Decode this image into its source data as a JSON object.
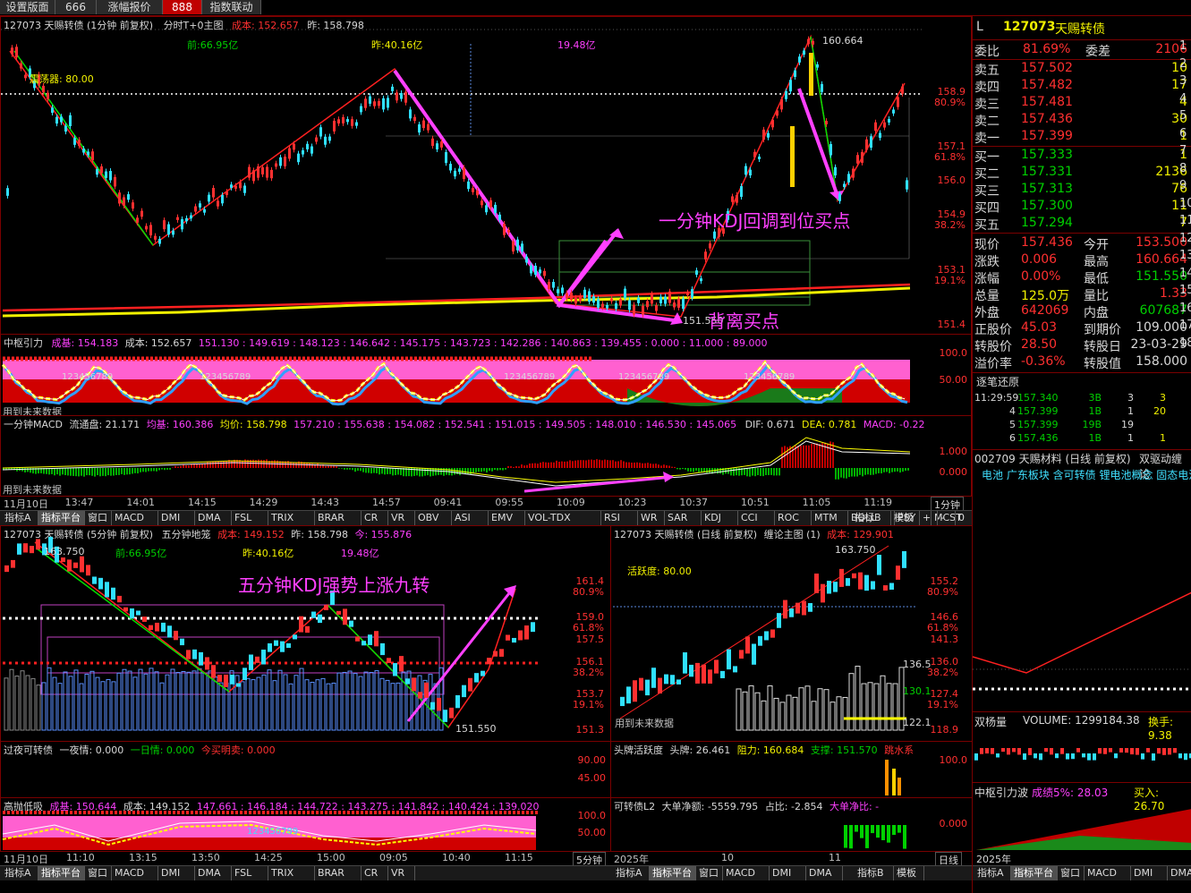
{
  "top_tabs": [
    "设置版面",
    "666",
    "涨幅报价",
    "888",
    "指数联动"
  ],
  "active_tab": "888",
  "minute_chart": {
    "title_code": "127073 天赐转债 (1分钟 前复权)",
    "title_mode": "分时T+0主图",
    "cost_label": "成本: 152.657",
    "prev_label": "昨: 158.798",
    "note_prev": "前:66.95亿",
    "note_yest": "昨:40.16亿",
    "note_amt": "19.48亿",
    "osc_label": "震荡器: 80.00",
    "high_label": "160.664",
    "low_label": "151.550",
    "y_ticks": [
      {
        "v": "158.9",
        "p": "80.9%"
      },
      {
        "v": "157.1",
        "p": "61.8%"
      },
      {
        "v": "156.0",
        "p": ""
      },
      {
        "v": "154.9",
        "p": "38.2%"
      },
      {
        "v": "153.1",
        "p": "19.1%"
      },
      {
        "v": "151.4",
        "p": ""
      }
    ],
    "annot_buy": "一分钟KDJ回调到位买点",
    "annot_div": "背离买点"
  },
  "zhongshu": {
    "title": "中枢引力",
    "cost_base": "成基: 154.183",
    "cost": "成本: 152.657",
    "levels": "151.130 : 149.619 : 148.123 : 146.642 : 145.175 : 143.723 : 142.286 : 140.863 : 139.455 : 0.000 : 11.000 : 89.000",
    "y1": "100.0",
    "y2": "50.00",
    "note": "用到未来数据",
    "seq": "123456789"
  },
  "macd": {
    "title": "一分钟MACD",
    "float": "流通盘: 21.171",
    "avgbase": "均基: 160.386",
    "avg": "均价: 158.798",
    "levels": "157.210 : 155.638 : 154.082 : 152.541 : 151.015 : 149.505 : 148.010 : 146.530 : 145.065",
    "dif": "DIF: 0.671",
    "dea": "DEA: 0.781",
    "macd": "MACD: -0.22",
    "y1": "1.000",
    "y2": "0.000",
    "note": "用到未来数据"
  },
  "minute_times": [
    "11月10日",
    "13:47",
    "14:01",
    "14:15",
    "14:29",
    "14:43",
    "14:57",
    "09:41",
    "09:55",
    "10:09",
    "10:23",
    "10:37",
    "10:51",
    "11:05",
    "11:19"
  ],
  "period_tag": "1分钟",
  "indicator_tabs": [
    "指标A",
    "指标平台",
    "窗口",
    "MACD",
    "DMI",
    "DMA",
    "FSL",
    "TRIX",
    "BRAR",
    "CR",
    "VR",
    "OBV",
    "ASI",
    "EMV",
    "VOL-TDX",
    "RSI",
    "WR",
    "SAR",
    "KDJ",
    "CCI",
    "ROC",
    "MTM",
    "BOLL",
    "PSY",
    "MCST",
    "更多",
    "设置",
    "指标B",
    "模板",
    "+",
    "-",
    "0"
  ],
  "five_min": {
    "title_code": "127073 天赐转债 (5分钟 前复权)",
    "title_mode": "五分钟地笼",
    "cost": "成本: 149.152",
    "prev": "昨: 158.798",
    "avg": "今: 155.876",
    "high_label": "163.750",
    "low_label": "151.550",
    "note_prev": "前:66.95亿",
    "note_yest": "昨:40.16亿",
    "note_amt": "19.48亿",
    "annot": "五分钟KDJ强势上涨九转",
    "y_ticks": [
      {
        "v": "161.4",
        "p": "80.9%"
      },
      {
        "v": "159.0",
        "p": "61.8%"
      },
      {
        "v": "157.5",
        "p": ""
      },
      {
        "v": "156.1",
        "p": "38.2%"
      },
      {
        "v": "153.7",
        "p": "19.1%"
      },
      {
        "v": "151.3",
        "p": ""
      }
    ]
  },
  "overnight": {
    "title": "过夜可转债",
    "mood": "一夜情: 0.000",
    "day": "一日情: 0.000",
    "today": "今买明卖: 0.000",
    "y1": "90.00",
    "y2": "45.00"
  },
  "high_low": {
    "title": "高抛低吸",
    "base": "成基: 150.644",
    "cost": "成本: 149.152",
    "levels": "147.661 : 146.184 : 144.722 : 143.275 : 141.842 : 140.424 : 139.020",
    "y1": "100.0",
    "y2": "50.00",
    "seq": "123456789"
  },
  "five_times": [
    "11月10日",
    "11:10",
    "13:15",
    "13:50",
    "14:25",
    "15:00",
    "09:05",
    "10:40",
    "11:15"
  ],
  "five_tag": "5分钟",
  "daily": {
    "title_code": "127073 天赐转债 (日线 前复权)",
    "title_mode": "缠论主图 (1)",
    "cost": "成本: 129.901",
    "activity": "活跃度: 80.00",
    "high_label": "163.750",
    "v1": "136.5",
    "v2": "130.1",
    "v3": "122.1",
    "y_ticks": [
      {
        "v": "155.2",
        "p": "80.9%"
      },
      {
        "v": "146.6",
        "p": "61.8%"
      },
      {
        "v": "141.3",
        "p": ""
      },
      {
        "v": "136.0",
        "p": "38.2%"
      },
      {
        "v": "127.4",
        "p": "19.1%"
      },
      {
        "v": "118.9",
        "p": ""
      }
    ],
    "note": "用到未来数据"
  },
  "head_activity": {
    "title": "头牌活跃度",
    "head": "头牌: 26.461",
    "resist": "阻力: 160.684",
    "support": "支撑: 151.570",
    "jump": "跳水系",
    "y1": "100.0"
  },
  "l2": {
    "title": "可转债L2",
    "net": "大单净额: -5559.795",
    "ratio": "占比: -2.854",
    "netratio": "大单净比: -",
    "y1": "0.000"
  },
  "daily_times": [
    "2025年",
    "10",
    "11"
  ],
  "daily_tag": "日线",
  "quote": {
    "code": "127073",
    "name": "天赐转债",
    "wb_label": "委比",
    "wb": "81.69%",
    "wc_label": "委差",
    "wc": "2106",
    "asks": [
      {
        "l": "卖五",
        "p": "157.502",
        "v": "10"
      },
      {
        "l": "卖四",
        "p": "157.482",
        "v": "17"
      },
      {
        "l": "卖三",
        "p": "157.481",
        "v": "4"
      },
      {
        "l": "卖二",
        "p": "157.436",
        "v": "30"
      },
      {
        "l": "卖一",
        "p": "157.399",
        "v": "1"
      }
    ],
    "bids": [
      {
        "l": "买一",
        "p": "157.333",
        "v": "1"
      },
      {
        "l": "买二",
        "p": "157.331",
        "v": "2136"
      },
      {
        "l": "买三",
        "p": "157.313",
        "v": "76"
      },
      {
        "l": "买四",
        "p": "157.300",
        "v": "11"
      },
      {
        "l": "买五",
        "p": "157.294",
        "v": "7"
      }
    ],
    "stats": [
      {
        "l1": "现价",
        "v1": "157.436",
        "l2": "今开",
        "v2": "153.500"
      },
      {
        "l1": "涨跌",
        "v1": "0.006",
        "l2": "最高",
        "v2": "160.664"
      },
      {
        "l1": "涨幅",
        "v1": "0.00%",
        "l2": "最低",
        "v2": "151.550"
      },
      {
        "l1": "总量",
        "v1": "125.0万",
        "l2": "量比",
        "v2": "1.33"
      },
      {
        "l1": "外盘",
        "v1": "642069",
        "l2": "内盘",
        "v2": "607687"
      },
      {
        "l1": "正股价",
        "v1": "45.03",
        "l2": "到期价",
        "v2": "109.000"
      },
      {
        "l1": "转股价",
        "v1": "28.50",
        "l2": "转股日",
        "v2": "23-03-29"
      },
      {
        "l1": "溢价率",
        "v1": "-0.36%",
        "l2": "转股值",
        "v2": "158.000"
      }
    ],
    "ticks_title": "逐笔还原",
    "ticks": [
      {
        "t": "11:29:59",
        "p": "157.340",
        "n": "3B",
        "a": "3",
        "b": "3"
      },
      {
        "t": "4",
        "p": "157.399",
        "n": "1B",
        "a": "1",
        "b": "20"
      },
      {
        "t": "5",
        "p": "157.399",
        "n": "19B",
        "a": "19",
        "b": ""
      },
      {
        "t": "6",
        "p": "157.436",
        "n": "1B",
        "a": "1",
        "b": "1"
      }
    ],
    "stock_line": "002709 天赐材料 (日线 前复权)",
    "stock_mode": "双驱动缠论",
    "concepts": "电池  广东板块  含可转债  锂电池概念  固态电池",
    "vol_title": "双杨量",
    "vol": "VOLUME: 1299184.38",
    "turnover": "换手: 9.38",
    "zs_title": "中枢引力波",
    "zs_rate": "成绩5%: 28.03",
    "zs_buy": "买入: 26.70",
    "year": "2025年",
    "right_nums": [
      "1",
      "2",
      "3",
      "4",
      "5",
      "6",
      "7",
      "8",
      "9",
      "10",
      "11",
      "12",
      "13",
      "14",
      "15",
      "16",
      "17",
      "18"
    ]
  },
  "bottom_tabs_left": [
    "指标A",
    "指标平台",
    "窗口",
    "MACD",
    "DMI",
    "DMA",
    "FSL",
    "TRIX",
    "BRAR",
    "CR",
    "VR"
  ],
  "bottom_tabs_mid": [
    "指标A",
    "指标平台",
    "窗口",
    "MACD",
    "DMI",
    "DMA"
  ],
  "bottom_tabs_right": [
    "指标A",
    "指标平台",
    "窗口",
    "MACD",
    "DMI",
    "DMA"
  ],
  "bottom_b": "指标B",
  "bottom_tpl": "模板"
}
